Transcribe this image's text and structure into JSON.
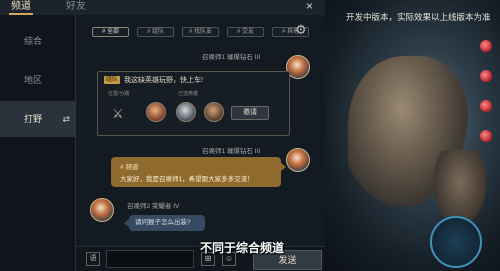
{
  "tabs": {
    "channel": "频道",
    "friends": "好友"
  },
  "close_icon": "×",
  "sidebar": {
    "items": [
      {
        "label": "综合"
      },
      {
        "label": "地区"
      },
      {
        "label": "打野",
        "active": true
      }
    ],
    "swap_icon": "⇄"
  },
  "filters": [
    "# 全部",
    "# 组队",
    "# 找队友",
    "# 交友",
    "# 其他"
  ],
  "gear_icon": "⚙",
  "messages": [
    {
      "sender": "召唤师1  璀璨钻石 III"
    },
    {
      "sender": "召唤师1  璀璨钻石 III"
    },
    {
      "sender": "召唤师2  荣耀者 IV"
    }
  ],
  "invite": {
    "tag": "组队",
    "text": "我这缺英雄玩野，快上车!",
    "position_label": "位置/分路",
    "heroes_label": "已选英雄",
    "invite_button": "邀请"
  },
  "gold_bubble": {
    "title": "# 频道",
    "text": "大家好，我是召唤师1，希望跟大家多多交流！"
  },
  "blue_bubble": {
    "text": "请问猴子怎么出装?"
  },
  "input": {
    "mic_icon": "语",
    "send_label": "发送",
    "emoji_icons": [
      "⊞",
      "☺"
    ]
  },
  "dev_note": "开发中版本，实际效果以上线版本为准",
  "subtitle": "不同于综合频道"
}
